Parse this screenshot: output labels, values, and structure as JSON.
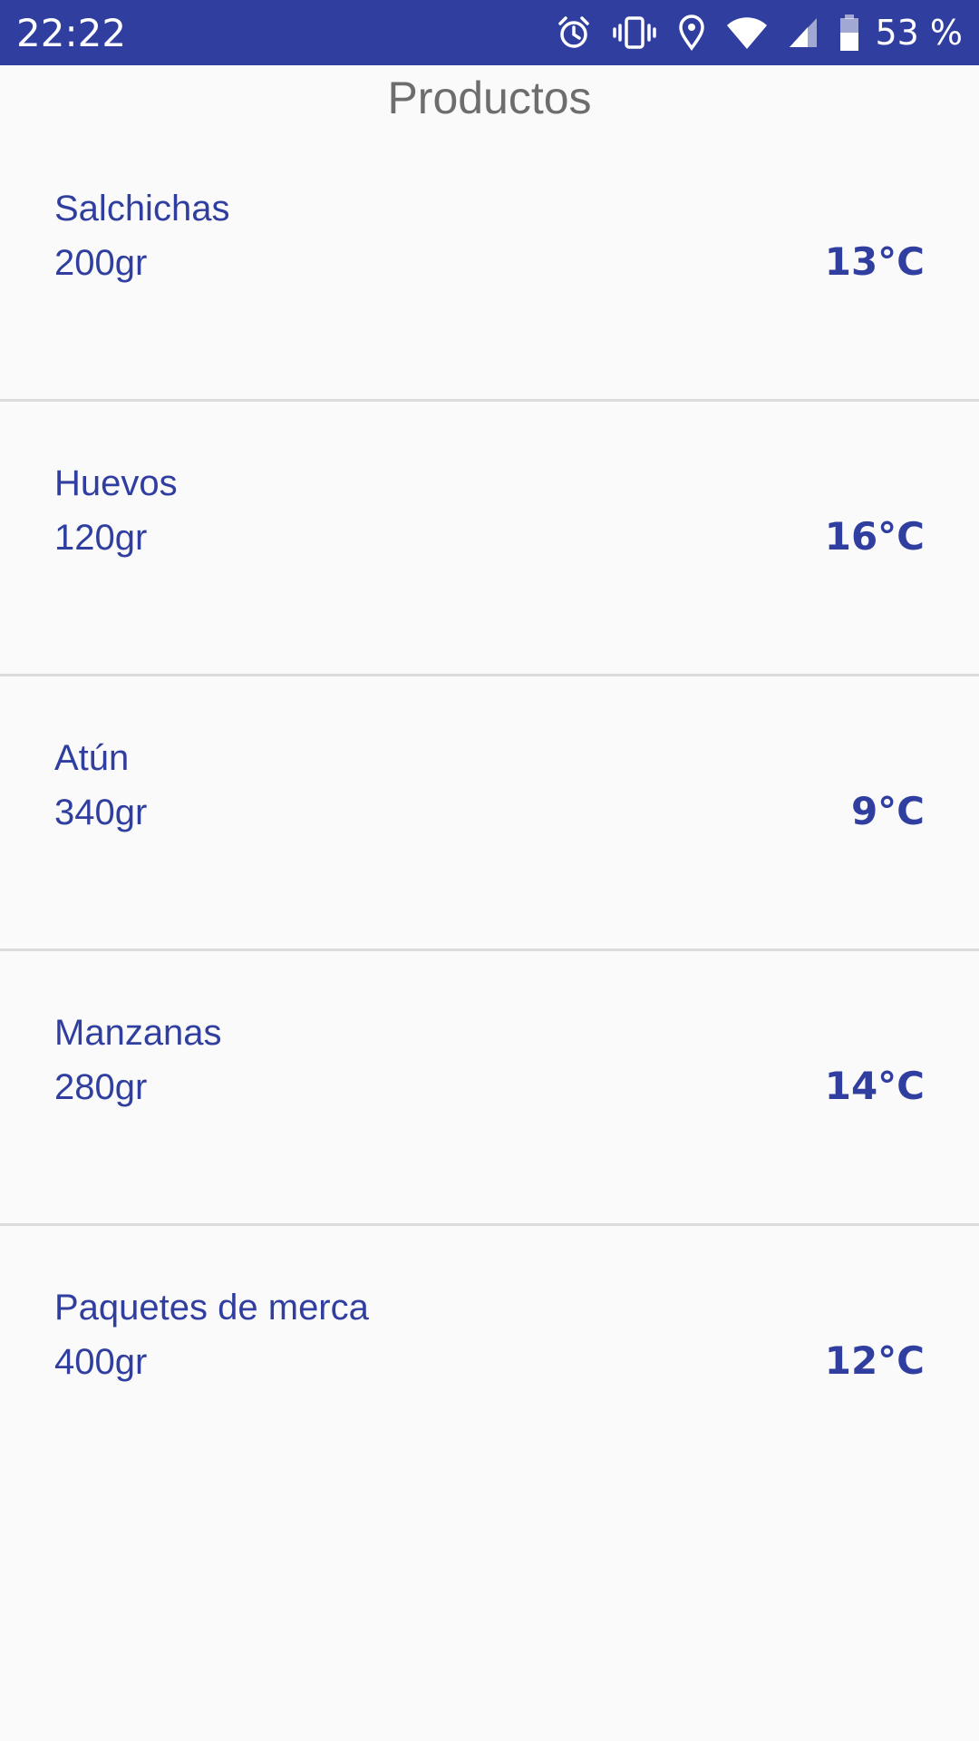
{
  "status_bar": {
    "time": "22:22",
    "battery_text": "53 %",
    "icons": [
      "alarm-icon",
      "vibrate-icon",
      "location-icon",
      "wifi-icon",
      "signal-icon",
      "battery-icon"
    ],
    "background": "#303f9f"
  },
  "page": {
    "title": "Productos"
  },
  "products": [
    {
      "name": "Salchichas",
      "weight": "200gr",
      "temperature": "13°C"
    },
    {
      "name": "Huevos",
      "weight": "120gr",
      "temperature": "16°C"
    },
    {
      "name": "Atún",
      "weight": "340gr",
      "temperature": "9°C"
    },
    {
      "name": "Manzanas",
      "weight": "280gr",
      "temperature": "14°C"
    },
    {
      "name": "Paquetes de merca",
      "weight": "400gr",
      "temperature": "12°C"
    }
  ],
  "colors": {
    "accent": "#303f9f",
    "title_gray": "#6d6d6d",
    "divider": "#dcdcdc",
    "background": "#fafafa"
  }
}
